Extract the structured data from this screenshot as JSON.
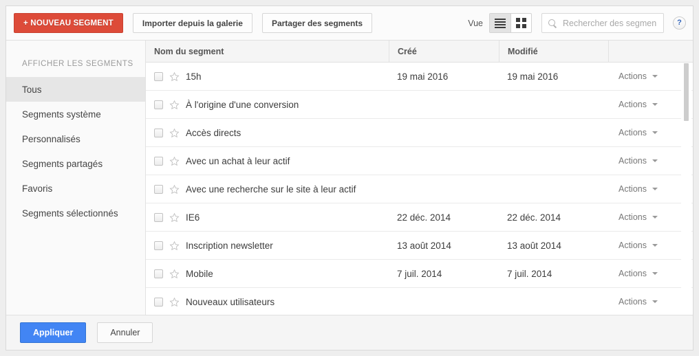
{
  "toolbar": {
    "new_segment_label": "+ NOUVEAU SEGMENT",
    "import_label": "Importer depuis la galerie",
    "share_label": "Partager des segments",
    "view_label": "Vue",
    "list_view_icon": "list-view-icon",
    "grid_view_icon": "grid-view-icon",
    "search_placeholder": "Rechercher des segments",
    "search_value": "",
    "search_icon": "search-icon",
    "help_label": "?",
    "accent_red": "#dd4b39"
  },
  "sidebar": {
    "title": "AFFICHER LES SEGMENTS",
    "items": [
      {
        "label": "Tous",
        "active": true
      },
      {
        "label": "Segments système",
        "active": false
      },
      {
        "label": "Personnalisés",
        "active": false
      },
      {
        "label": "Segments partagés",
        "active": false
      },
      {
        "label": "Favoris",
        "active": false
      },
      {
        "label": "Segments sélectionnés",
        "active": false
      }
    ]
  },
  "table": {
    "columns": {
      "name": "Nom du segment",
      "created": "Créé",
      "modified": "Modifié",
      "actions": ""
    },
    "actions_label": "Actions",
    "rows": [
      {
        "name": "15h",
        "created": "19 mai 2016",
        "modified": "19 mai 2016",
        "actions": "Actions",
        "starred": false,
        "checked": false
      },
      {
        "name": "À l'origine d'une conversion",
        "created": "",
        "modified": "",
        "actions": "Actions",
        "starred": false,
        "checked": false
      },
      {
        "name": "Accès directs",
        "created": "",
        "modified": "",
        "actions": "Actions",
        "starred": false,
        "checked": false
      },
      {
        "name": "Avec un achat à leur actif",
        "created": "",
        "modified": "",
        "actions": "Actions",
        "starred": false,
        "checked": false
      },
      {
        "name": "Avec une recherche sur le site à leur actif",
        "created": "",
        "modified": "",
        "actions": "Actions",
        "starred": false,
        "checked": false
      },
      {
        "name": "IE6",
        "created": "22 déc. 2014",
        "modified": "22 déc. 2014",
        "actions": "Actions",
        "starred": false,
        "checked": false
      },
      {
        "name": "Inscription newsletter",
        "created": "13 août 2014",
        "modified": "13 août 2014",
        "actions": "Actions",
        "starred": false,
        "checked": false
      },
      {
        "name": "Mobile",
        "created": "7 juil. 2014",
        "modified": "7 juil. 2014",
        "actions": "Actions",
        "starred": false,
        "checked": false
      },
      {
        "name": "Nouveaux utilisateurs",
        "created": "",
        "modified": "",
        "actions": "Actions",
        "starred": false,
        "checked": false
      }
    ]
  },
  "footer": {
    "apply_label": "Appliquer",
    "cancel_label": "Annuler",
    "apply_color": "#4285f4"
  }
}
